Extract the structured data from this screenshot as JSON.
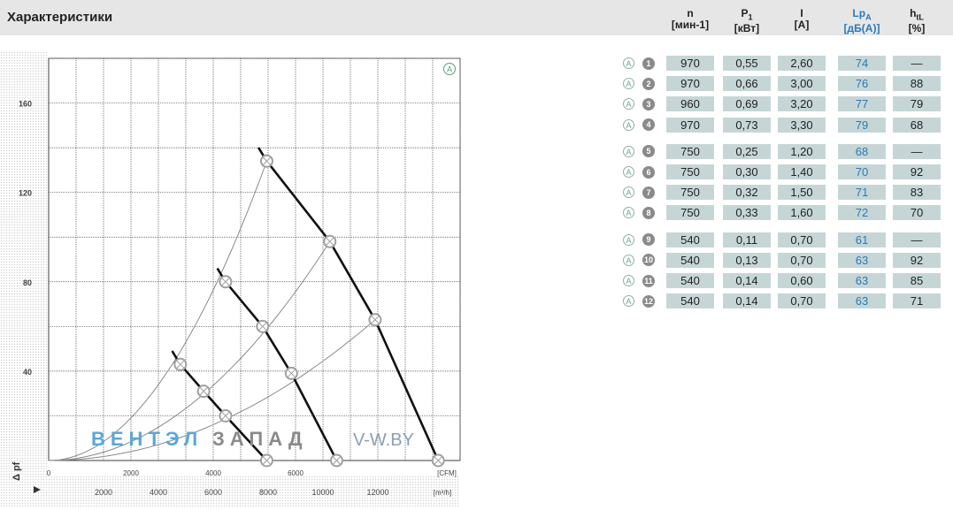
{
  "header": {
    "title": "Характеристики",
    "columns": [
      {
        "main": "n",
        "sub": "",
        "unit": "[мин-1]",
        "blue": false
      },
      {
        "main": "P",
        "sub": "1",
        "unit": "[кВт]",
        "blue": false
      },
      {
        "main": "I",
        "sub": "",
        "unit": "[A]",
        "blue": false
      },
      {
        "main": "Lp",
        "sub": "A",
        "unit": "[дБ(A)]",
        "blue": true
      },
      {
        "main": "h",
        "sub": "tL",
        "unit": "[%]",
        "blue": false
      }
    ]
  },
  "table": {
    "rows": [
      {
        "a": "A",
        "num": "1",
        "n": "970",
        "p1": "0,55",
        "i": "2,60",
        "lp": "74",
        "h": "—"
      },
      {
        "a": "A",
        "num": "2",
        "n": "970",
        "p1": "0,66",
        "i": "3,00",
        "lp": "76",
        "h": "88"
      },
      {
        "a": "A",
        "num": "3",
        "n": "960",
        "p1": "0,69",
        "i": "3,20",
        "lp": "77",
        "h": "79"
      },
      {
        "a": "A",
        "num": "4",
        "n": "970",
        "p1": "0,73",
        "i": "3,30",
        "lp": "79",
        "h": "68"
      },
      {
        "a": "A",
        "num": "5",
        "n": "750",
        "p1": "0,25",
        "i": "1,20",
        "lp": "68",
        "h": "—"
      },
      {
        "a": "A",
        "num": "6",
        "n": "750",
        "p1": "0,30",
        "i": "1,40",
        "lp": "70",
        "h": "92"
      },
      {
        "a": "A",
        "num": "7",
        "n": "750",
        "p1": "0,32",
        "i": "1,50",
        "lp": "71",
        "h": "83"
      },
      {
        "a": "A",
        "num": "8",
        "n": "750",
        "p1": "0,33",
        "i": "1,60",
        "lp": "72",
        "h": "70"
      },
      {
        "a": "A",
        "num": "9",
        "n": "540",
        "p1": "0,11",
        "i": "0,70",
        "lp": "61",
        "h": "—"
      },
      {
        "a": "A",
        "num": "10",
        "n": "540",
        "p1": "0,13",
        "i": "0,70",
        "lp": "63",
        "h": "92"
      },
      {
        "a": "A",
        "num": "11",
        "n": "540",
        "p1": "0,14",
        "i": "0,60",
        "lp": "63",
        "h": "85"
      },
      {
        "a": "A",
        "num": "12",
        "n": "540",
        "p1": "0,14",
        "i": "0,70",
        "lp": "63",
        "h": "71"
      }
    ]
  },
  "chart_data": {
    "type": "line",
    "corner_label": "A",
    "watermark": {
      "part1": "ВЕНТЭЛ",
      "part2": "ЗАПАД",
      "part3": "V-W.BY"
    },
    "y_ticks": [
      "40",
      "80",
      "120",
      "160"
    ],
    "y_label": "Δ pf",
    "x_ticks_m3h": [
      "2000",
      "4000",
      "6000",
      "8000",
      "10000",
      "12000"
    ],
    "x_unit_m3h": "[m³/h]",
    "x_ticks_cfm": [
      "0",
      "2000",
      "4000",
      "6000"
    ],
    "x_unit_cfm": "[CFM]",
    "xlim": [
      0,
      15000
    ],
    "ylim": [
      0,
      180
    ],
    "colors": {
      "curve": "#111111",
      "system": "#8a8a8a",
      "marker": "#a0a0a0",
      "grid": "#444444"
    },
    "series": [
      {
        "points": [
          [
            7950,
            134
          ],
          [
            10250,
            98
          ],
          [
            11900,
            63
          ],
          [
            14200,
            0
          ]
        ]
      },
      {
        "points": [
          [
            6450,
            80
          ],
          [
            7800,
            60
          ],
          [
            8850,
            39
          ],
          [
            10500,
            0
          ]
        ]
      },
      {
        "points": [
          [
            4800,
            43
          ],
          [
            5650,
            31
          ],
          [
            6450,
            20
          ],
          [
            7950,
            0
          ]
        ]
      }
    ],
    "system_curves": [
      {
        "points": [
          [
            0,
            0
          ],
          [
            4800,
            43
          ],
          [
            6450,
            80
          ],
          [
            7950,
            134
          ]
        ]
      },
      {
        "points": [
          [
            0,
            0
          ],
          [
            5650,
            31
          ],
          [
            7800,
            60
          ],
          [
            10250,
            98
          ]
        ]
      },
      {
        "points": [
          [
            0,
            0
          ],
          [
            6450,
            20
          ],
          [
            8850,
            39
          ],
          [
            11900,
            63
          ]
        ]
      }
    ]
  }
}
